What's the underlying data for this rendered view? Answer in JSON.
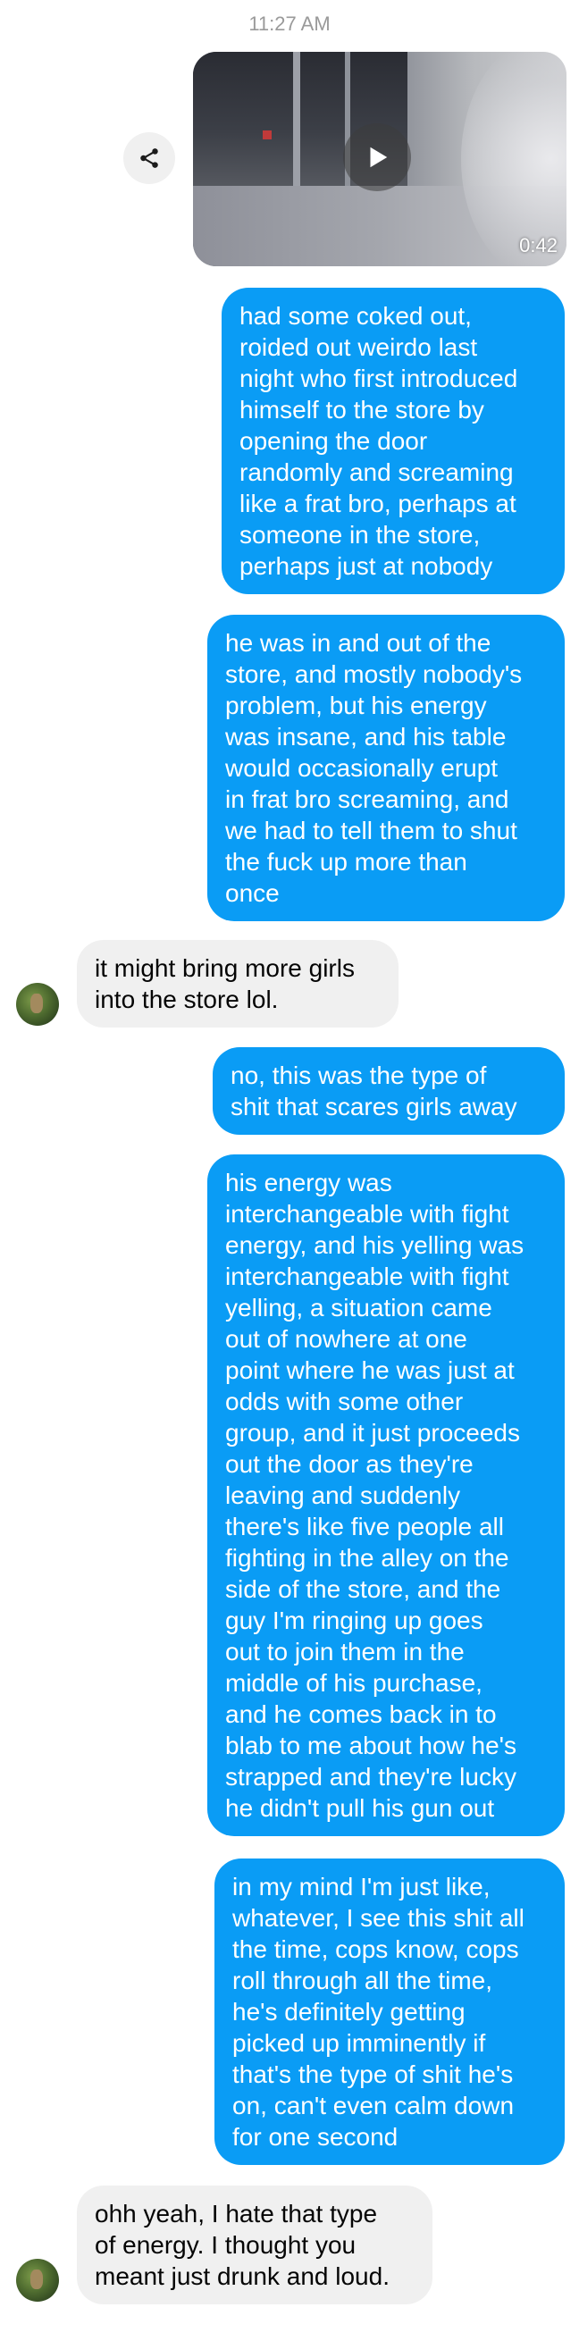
{
  "header": {
    "timestamp": "11:27 AM"
  },
  "video": {
    "duration": "0:42",
    "share_icon": "share-icon",
    "play_icon": "play-icon"
  },
  "colors": {
    "outgoing_bubble": "#0a9cf5",
    "incoming_bubble": "#f0f0f0",
    "timestamp_text": "#9a9a9a"
  },
  "messages": [
    {
      "direction": "outgoing",
      "text": "had some coked out,\nroided out weirdo last\nnight who first introduced\nhimself to the store by\nopening the door\nrandomly and screaming\nlike a frat bro, perhaps at\nsomeone in the store,\nperhaps just at nobody"
    },
    {
      "direction": "outgoing",
      "text": "he was in and out of the\nstore, and mostly nobody's\nproblem, but his energy\nwas insane, and his table\nwould occasionally erupt\nin frat bro screaming, and\nwe had to tell them to shut\nthe fuck up more than\nonce"
    },
    {
      "direction": "incoming",
      "text": "it might bring more girls\ninto the store lol."
    },
    {
      "direction": "outgoing",
      "text": "no, this was the type of\nshit that scares girls away"
    },
    {
      "direction": "outgoing",
      "text": "his energy was\ninterchangeable with fight\nenergy, and his yelling was\ninterchangeable with fight\nyelling, a situation came\nout of nowhere at one\npoint where he was just at\nodds with some other\ngroup, and it just proceeds\nout the door as they're\nleaving and suddenly\nthere's like five people all\nfighting in the alley on the\nside of the store, and the\nguy I'm ringing up goes\nout to join them in the\nmiddle of his purchase,\nand he comes back in to\nblab to me about how he's\nstrapped and they're lucky\nhe didn't pull his gun out"
    },
    {
      "direction": "outgoing",
      "text": "in my mind I'm just like,\nwhatever, I see this shit all\nthe time, cops know, cops\nroll through all the time,\nhe's definitely getting\npicked up imminently if\nthat's the type of shit he's\non, can't even calm down\nfor one second"
    },
    {
      "direction": "incoming",
      "text": "ohh yeah, I hate that type\nof energy. I thought you\nmeant just drunk and loud."
    }
  ]
}
